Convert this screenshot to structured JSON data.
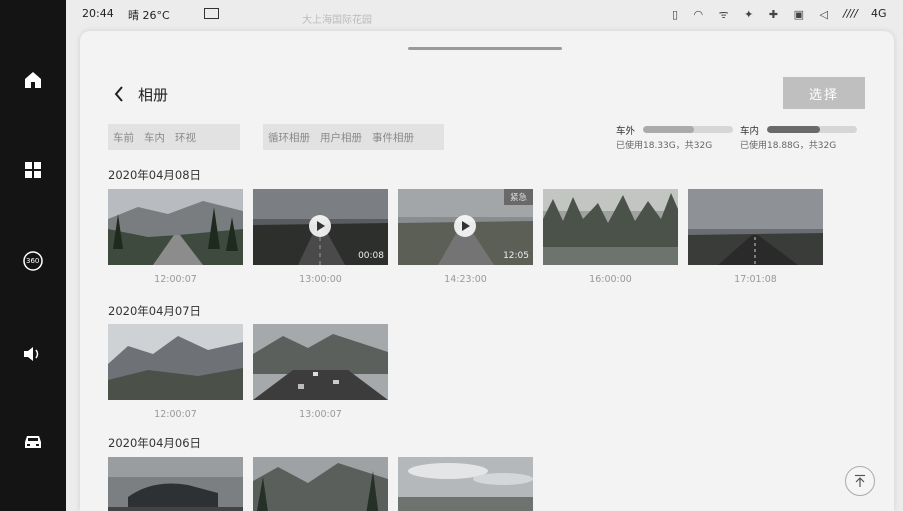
{
  "status_bar": {
    "time": "20:44",
    "weather": "晴 26°C",
    "map_label": "大上海国际花园",
    "signal": "4G",
    "signal_bars": "////"
  },
  "dock": {
    "items": [
      {
        "icon": "home-icon"
      },
      {
        "icon": "apps-grid-icon"
      },
      {
        "icon": "camera-360-icon",
        "label": "360"
      },
      {
        "icon": "volume-icon"
      },
      {
        "icon": "car-icon"
      }
    ]
  },
  "album": {
    "title": "相册",
    "select_label": "选择",
    "camera_tabs": [
      "车前",
      "车内",
      "环视"
    ],
    "album_tabs": [
      "循环相册",
      "用户相册",
      "事件相册"
    ],
    "storage": [
      {
        "label": "车外",
        "text": "已使用18.33G，共32G",
        "used_fraction": 0.57,
        "color": "#aaaaaa"
      },
      {
        "label": "车内",
        "text": "已使用18.88G，共32G",
        "used_fraction": 0.59,
        "color": "#6a6a6a"
      }
    ],
    "sections": [
      {
        "date": "2020年04月08日",
        "items": [
          {
            "time": "12:00:07",
            "scene": "road-trees"
          },
          {
            "time": "13:00:00",
            "scene": "highway-dusk",
            "video": true,
            "duration": "00:08"
          },
          {
            "time": "14:23:00",
            "scene": "highway-plain",
            "video": true,
            "duration": "12:05",
            "badge": "紧急"
          },
          {
            "time": "16:00:00",
            "scene": "forest"
          },
          {
            "time": "17:01:08",
            "scene": "desert-road"
          }
        ]
      },
      {
        "date": "2020年04月07日",
        "items": [
          {
            "time": "12:00:07",
            "scene": "mountains"
          },
          {
            "time": "13:00:07",
            "scene": "freeway"
          }
        ]
      },
      {
        "date": "2020年04月06日",
        "items": [
          {
            "scene": "car"
          },
          {
            "scene": "mountain-valley"
          },
          {
            "scene": "clouds-plain"
          }
        ]
      }
    ],
    "scroll_top_icon": "arrow-up-icon"
  }
}
